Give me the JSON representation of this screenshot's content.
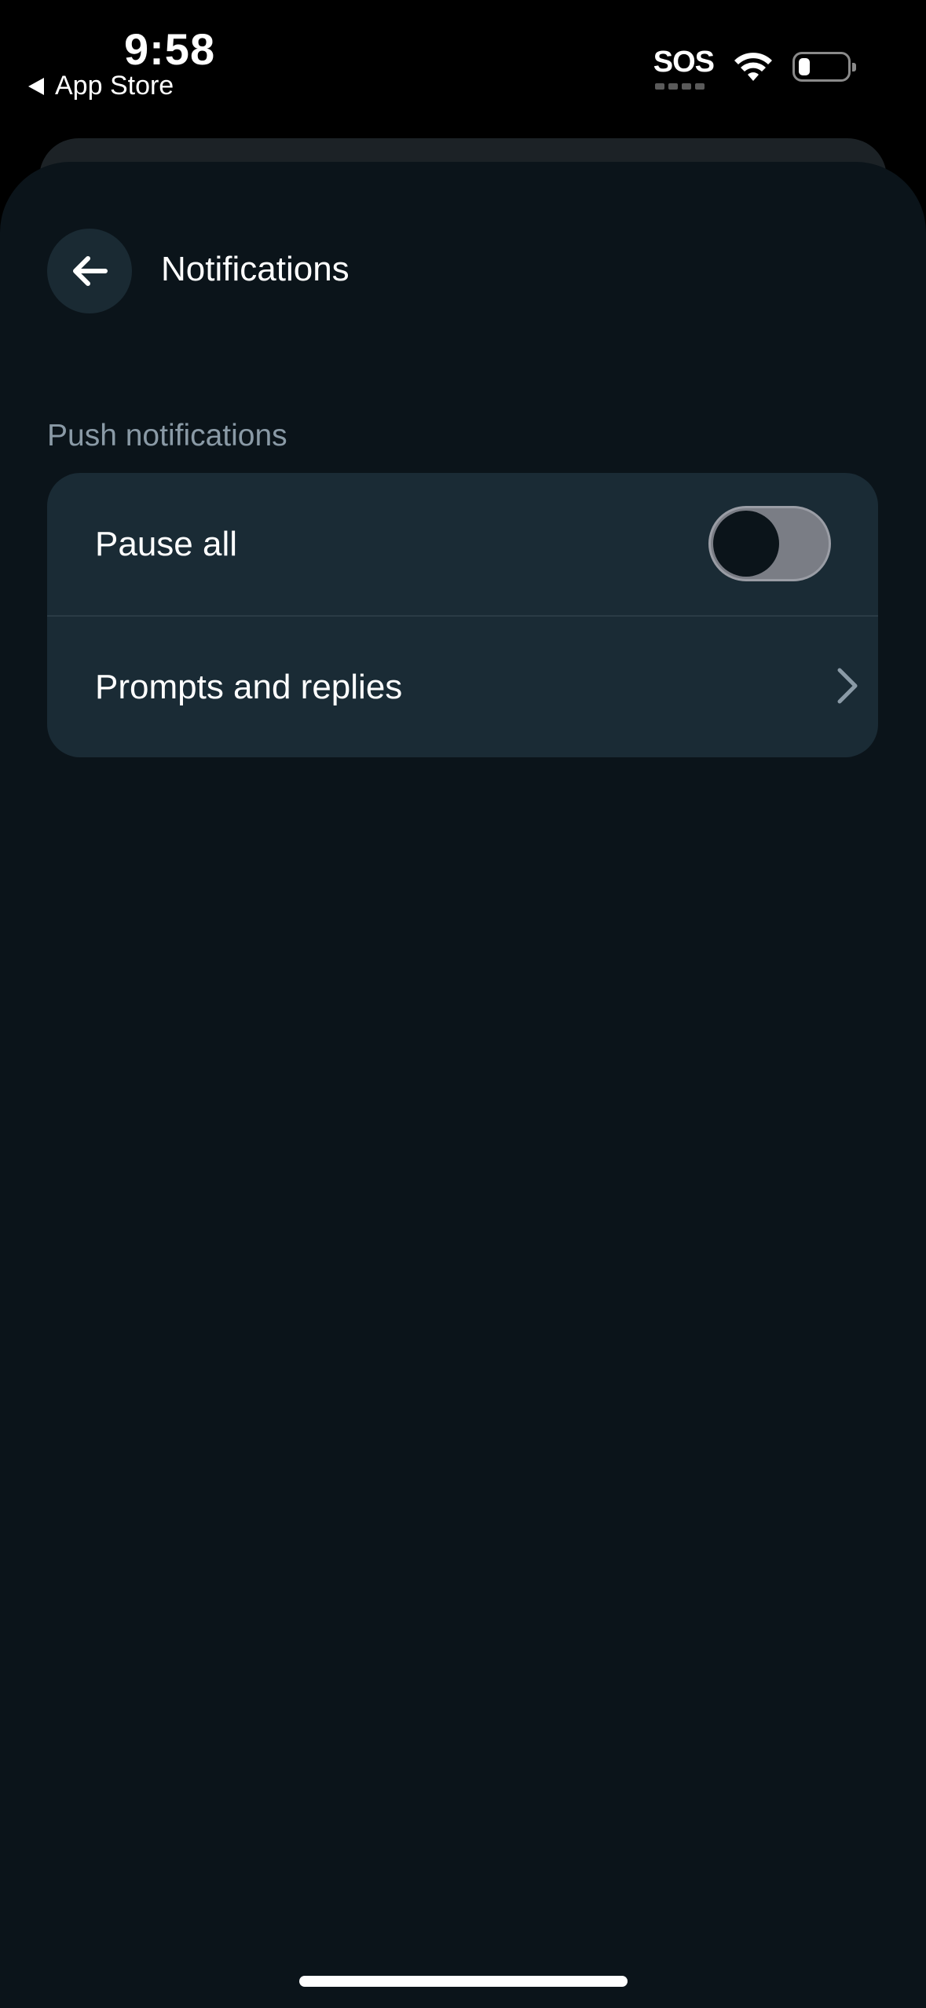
{
  "status_bar": {
    "time": "9:58",
    "back_app_label": "App Store",
    "sos_label": "SOS",
    "battery_level": 0.15
  },
  "header": {
    "title": "Notifications"
  },
  "push_notifications": {
    "section_label": "Push notifications",
    "items": [
      {
        "label": "Pause all",
        "control": "toggle",
        "toggle_on": false
      },
      {
        "label": "Prompts and replies",
        "control": "chevron"
      }
    ]
  },
  "colors": {
    "background": "#0b141a",
    "card": "#1a2b35",
    "section_label": "#8a9aa6",
    "toggle_off": "#7a7d85"
  },
  "icons": {
    "back": "arrow-left-icon",
    "chevron": "chevron-right-icon",
    "wifi": "wifi-icon",
    "battery": "battery-icon"
  }
}
